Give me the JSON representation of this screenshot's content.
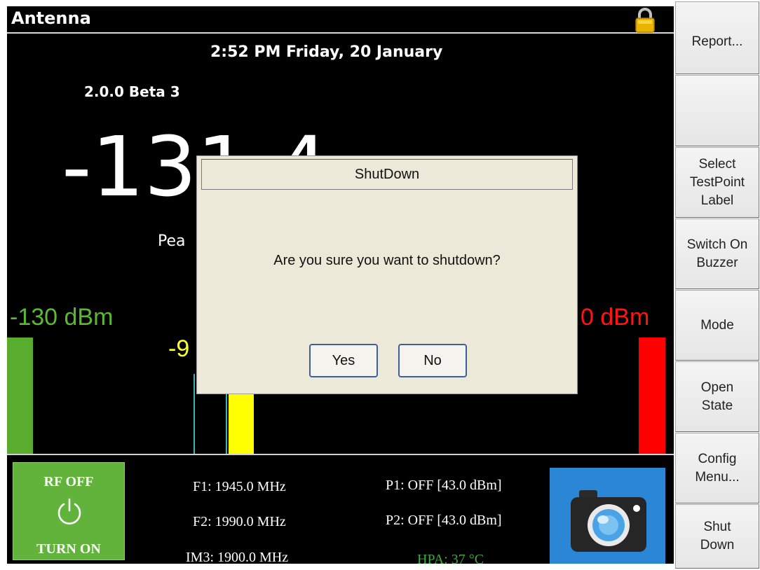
{
  "header": {
    "title": "Antenna"
  },
  "datetime": "2:52 PM Friday, 20 January",
  "version": "2.0.0 Beta 3",
  "reading": {
    "value": "-131.4",
    "peak_label": "Pea"
  },
  "scale": {
    "min_label": "-130 dBm",
    "max_label": "0 dBm",
    "mid_label": "-9"
  },
  "bottom": {
    "rf_state": "RF OFF",
    "rf_action": "TURN ON",
    "f1": "F1: 1945.0 MHz",
    "f2": "F2: 1990.0 MHz",
    "im3": "IM3: 1900.0 MHz",
    "p1": "P1: OFF [43.0 dBm]",
    "p2": "P2: OFF [43.0 dBm]",
    "hpa": "HPA: 37 °C"
  },
  "dialog": {
    "title": "ShutDown",
    "message": "Are you sure you want to shutdown?",
    "yes_label": "Yes",
    "no_label": "No"
  },
  "side_buttons": [
    {
      "label": "Report..."
    },
    {
      "label": ""
    },
    {
      "label": "Select\nTestPoint\nLabel"
    },
    {
      "label": "Switch On\nBuzzer"
    },
    {
      "label": "Mode"
    },
    {
      "label": "Open\nState"
    },
    {
      "label": "Config\nMenu..."
    },
    {
      "label": "Shut\nDown"
    }
  ],
  "colors": {
    "min_green": "#59ad2e",
    "max_red": "#ff0000",
    "mid_yellow": "#ffff00",
    "rf_button_green": "#62b33b",
    "camera_blue": "#2b86d6",
    "lock_gold": "#e8b400"
  },
  "icons": {
    "lock": "lock-icon",
    "power": "power-icon",
    "camera": "camera-icon"
  }
}
